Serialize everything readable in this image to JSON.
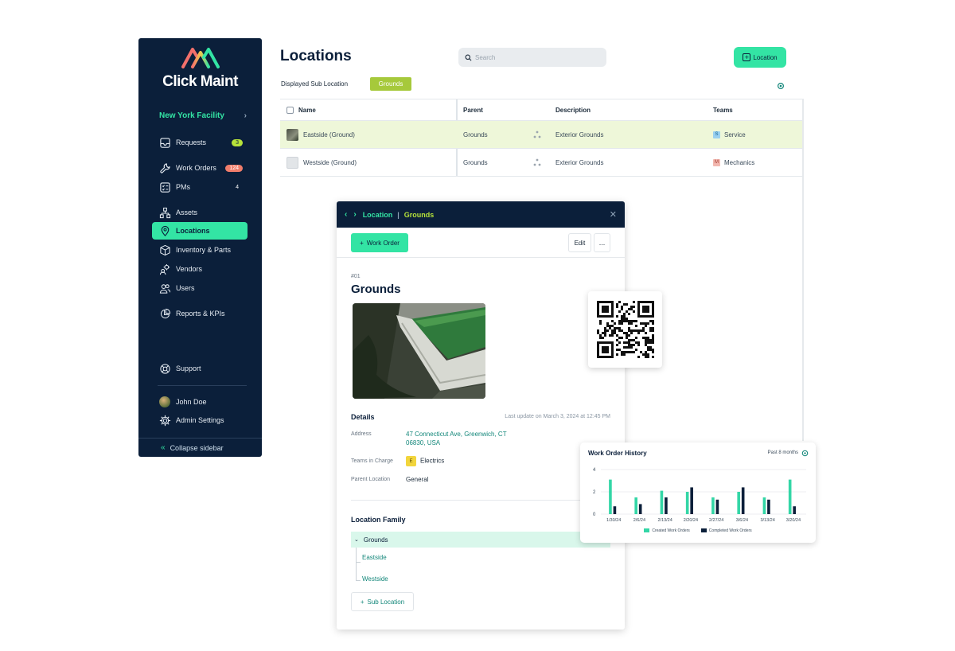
{
  "app": {
    "brand": "Click Maint"
  },
  "sidebar": {
    "facility": "New York Facility",
    "items": [
      {
        "label": "Requests",
        "badge": "3",
        "icon": "inbox-icon"
      },
      {
        "label": "Work Orders",
        "badge": "124",
        "icon": "wrench-icon"
      },
      {
        "label": "PMs",
        "badge": "4",
        "icon": "checklist-icon"
      },
      {
        "label": "Assets",
        "icon": "hierarchy-icon"
      },
      {
        "label": "Locations",
        "icon": "map-pin-icon"
      },
      {
        "label": "Inventory & Parts",
        "icon": "box-icon"
      },
      {
        "label": "Vendors",
        "icon": "vendor-gear-icon"
      },
      {
        "label": "Users",
        "icon": "users-icon"
      },
      {
        "label": "Reports & KPIs",
        "icon": "pie-chart-icon"
      }
    ],
    "support": "Support",
    "user": "John Doe",
    "admin": "Admin Settings",
    "collapse": "Collapse sidebar"
  },
  "header": {
    "title": "Locations",
    "search_placeholder": "Search",
    "add_button": "Location",
    "sub_label": "Displayed Sub Location",
    "sub_value": "Grounds"
  },
  "table": {
    "columns": {
      "name": "Name",
      "parent": "Parent",
      "description": "Description",
      "teams": "Teams"
    },
    "rows": [
      {
        "name": "Eastside (Ground)",
        "parent": "Grounds",
        "description": "Exterior Grounds",
        "team_tag": "S",
        "team": "Service"
      },
      {
        "name": "Westside (Ground)",
        "parent": "Grounds",
        "description": "Exterior Grounds",
        "team_tag": "M",
        "team": "Mechanics"
      }
    ]
  },
  "panel": {
    "crumb_1": "Location",
    "crumb_2": "Grounds",
    "work_order_btn": "Work Order",
    "edit_btn": "Edit",
    "more_btn": "...",
    "id": "#01",
    "name": "Grounds",
    "details_title": "Details",
    "last_update": "Last update on March 3, 2024 at 12:45 PM",
    "address_label": "Address",
    "address": "47 Connecticut Ave, Greenwich, CT 06830, USA",
    "teams_label": "Teams in Charge",
    "team_tag": "E",
    "team": "Electrics",
    "parent_label": "Parent Location",
    "parent": "General",
    "family_title": "Location Family",
    "family_root": "Grounds",
    "family_children": [
      "Eastside",
      "Westside"
    ],
    "sub_location_btn": "Sub Location"
  },
  "colors": {
    "navy": "#0b1f3a",
    "mint": "#33e4a4",
    "lime": "#a6c93b",
    "teal_text": "#13877a"
  },
  "chart_data": {
    "type": "bar",
    "title": "Work Order History",
    "range": "Past 8 months",
    "categories": [
      "1/30/24",
      "2/6/24",
      "2/13/24",
      "2/20/24",
      "2/27/24",
      "3/6/24",
      "3/13/24",
      "3/20/24"
    ],
    "series": [
      {
        "name": "Created Work Orders",
        "color": "#33d6a6",
        "values": [
          3.1,
          1.5,
          2.1,
          2.0,
          1.5,
          2.0,
          1.5,
          3.1
        ]
      },
      {
        "name": "Completed Work Orders",
        "color": "#0b1f3a",
        "values": [
          0.7,
          0.9,
          1.5,
          2.4,
          1.3,
          2.4,
          1.3,
          0.7
        ]
      }
    ],
    "y_ticks": [
      "4",
      "2",
      "0"
    ],
    "ylim": [
      0,
      4
    ],
    "grid": true,
    "legend": "bottom"
  }
}
